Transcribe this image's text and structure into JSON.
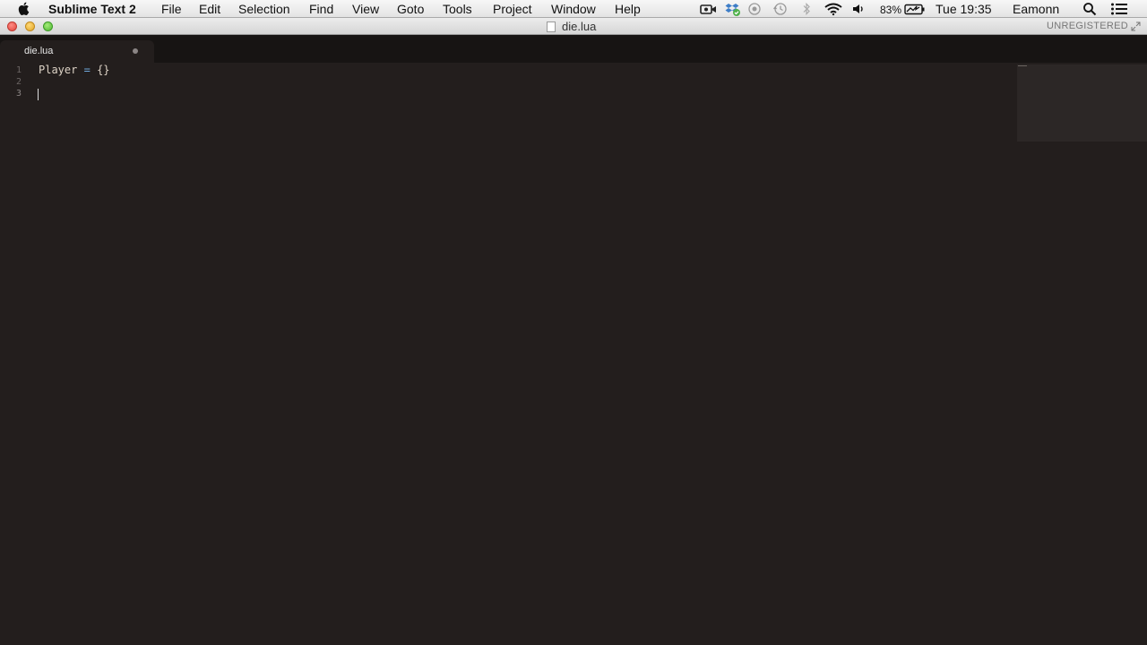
{
  "menubar": {
    "app_name": "Sublime Text 2",
    "menus": [
      "File",
      "Edit",
      "Selection",
      "Find",
      "View",
      "Goto",
      "Tools",
      "Project",
      "Window",
      "Help"
    ],
    "tray": {
      "battery": "83%",
      "clock": "Tue 19:35",
      "user": "Eamonn"
    },
    "icons": [
      "apple-icon",
      "facetime-camera-icon",
      "dropbox-sync-icon",
      "gamecenter-icon",
      "time-machine-icon",
      "bluetooth-icon",
      "wifi-icon",
      "volume-icon",
      "battery-charging-icon",
      "spotlight-search-icon",
      "notification-center-icon"
    ]
  },
  "window": {
    "title": "die.lua",
    "license_status": "UNREGISTERED"
  },
  "tabs": [
    {
      "label": "die.lua",
      "dirty": true,
      "active": true
    }
  ],
  "editor": {
    "line_numbers": [
      "1",
      "2",
      "3"
    ],
    "lines": [
      {
        "identifier": "Player",
        "operator": "=",
        "value": "{}"
      },
      {
        "text": ""
      },
      {
        "text": ""
      }
    ],
    "cursor_line": "3"
  },
  "colors": {
    "editor_bg": "#231e1d",
    "tab_bar_bg": "#171413",
    "operator": "#6fa8dc"
  }
}
